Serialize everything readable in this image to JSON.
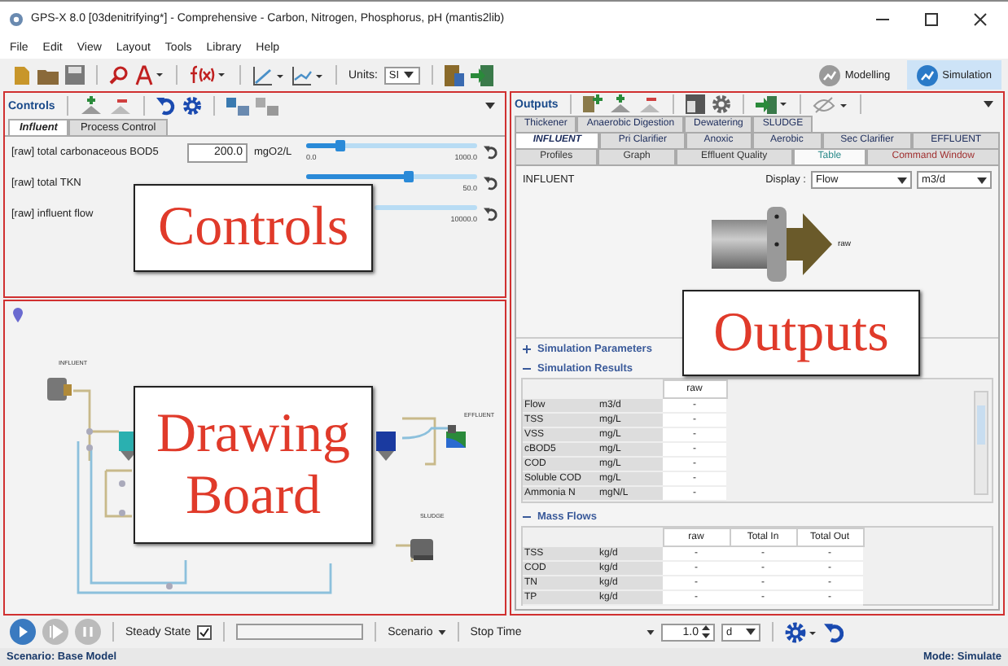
{
  "window": {
    "title": "GPS-X 8.0 [03denitrifying*] - Comprehensive - Carbon, Nitrogen, Phosphorus, pH (mantis2lib)"
  },
  "menu": [
    "File",
    "Edit",
    "View",
    "Layout",
    "Tools",
    "Library",
    "Help"
  ],
  "toolbar": {
    "units_label": "Units:",
    "units_value": "SI",
    "modes": [
      {
        "label": "Modelling",
        "selected": false
      },
      {
        "label": "Simulation",
        "selected": true
      }
    ]
  },
  "controls": {
    "title": "Controls",
    "tabs": [
      {
        "label": "Influent",
        "selected": true
      },
      {
        "label": "Process Control",
        "selected": false
      }
    ],
    "rows": [
      {
        "label": "[raw] total carbonaceous BOD5",
        "value": "200.0",
        "unit": "mgO2/L",
        "level": 0.2,
        "min": "0.0",
        "max": "1000.0"
      },
      {
        "label": "[raw] total TKN",
        "level": 0.6,
        "max": "50.0"
      },
      {
        "label": "[raw] influent flow",
        "max": "10000.0"
      }
    ]
  },
  "drawing_board": {
    "units": [
      {
        "label": "INFLUENT"
      },
      {
        "label": "EFFLUENT"
      },
      {
        "label": "SLUDGE"
      }
    ]
  },
  "outputs": {
    "title": "Outputs",
    "tab_rows": [
      {
        "tabs": [
          {
            "label": "Thickener",
            "selected": false
          },
          {
            "label": "Anaerobic Digestion",
            "selected": false
          },
          {
            "label": "Dewatering",
            "selected": false
          },
          {
            "label": "SLUDGE",
            "selected": false
          }
        ]
      },
      {
        "tabs": [
          {
            "label": "INFLUENT",
            "selected": true
          },
          {
            "label": "Pri Clarifier",
            "selected": false
          },
          {
            "label": "Anoxic",
            "selected": false
          },
          {
            "label": "Aerobic",
            "selected": false
          },
          {
            "label": "Sec Clarifier",
            "selected": false
          },
          {
            "label": "EFFLUENT",
            "selected": false
          }
        ]
      },
      {
        "tabs": [
          {
            "label": "Profiles",
            "selected": false,
            "color": "#333333"
          },
          {
            "label": "Graph",
            "selected": false,
            "color": "#333333"
          },
          {
            "label": "Effluent Quality",
            "selected": false,
            "color": "#333333"
          },
          {
            "label": "Table",
            "selected": true,
            "color": "#2a8a8a"
          },
          {
            "label": "Command Window",
            "selected": false,
            "color": "#a03030"
          }
        ]
      }
    ],
    "view": {
      "title": "INFLUENT",
      "display_label": "Display :",
      "display_value": "Flow",
      "unit_value": "m3/d",
      "stream_label": "raw"
    },
    "sections": [
      {
        "label": "Simulation Parameters",
        "expanded": false
      },
      {
        "label": "Simulation Results",
        "expanded": true,
        "columns": [
          "raw"
        ],
        "rows": [
          {
            "name": "Flow",
            "unit": "m3/d",
            "values": [
              "-"
            ]
          },
          {
            "name": "TSS",
            "unit": "mg/L",
            "values": [
              "-"
            ]
          },
          {
            "name": "VSS",
            "unit": "mg/L",
            "values": [
              "-"
            ]
          },
          {
            "name": "cBOD5",
            "unit": "mg/L",
            "values": [
              "-"
            ]
          },
          {
            "name": "COD",
            "unit": "mg/L",
            "values": [
              "-"
            ]
          },
          {
            "name": "Soluble COD",
            "unit": "mg/L",
            "values": [
              "-"
            ]
          },
          {
            "name": "Ammonia N",
            "unit": "mgN/L",
            "values": [
              "-"
            ]
          }
        ]
      },
      {
        "label": "Mass Flows",
        "expanded": true,
        "columns": [
          "raw",
          "Total In",
          "Total Out"
        ],
        "rows": [
          {
            "name": "TSS",
            "unit": "kg/d",
            "values": [
              "-",
              "-",
              "-"
            ]
          },
          {
            "name": "COD",
            "unit": "kg/d",
            "values": [
              "-",
              "-",
              "-"
            ]
          },
          {
            "name": "TN",
            "unit": "kg/d",
            "values": [
              "-",
              "-",
              "-"
            ]
          },
          {
            "name": "TP",
            "unit": "kg/d",
            "values": [
              "-",
              "-",
              "-"
            ]
          }
        ]
      }
    ]
  },
  "bottom_bar": {
    "steady_state": {
      "label": "Steady State",
      "checked": true
    },
    "scenario": "Scenario",
    "stop_time": "Stop Time",
    "time_value": "1.0",
    "time_unit": "d"
  },
  "status_bar": {
    "left": "Scenario: Base Model",
    "right": "Mode: Simulate"
  },
  "callouts": [
    {
      "label": "Controls"
    },
    {
      "label": "Drawing Board"
    },
    {
      "label": "Outputs"
    }
  ]
}
